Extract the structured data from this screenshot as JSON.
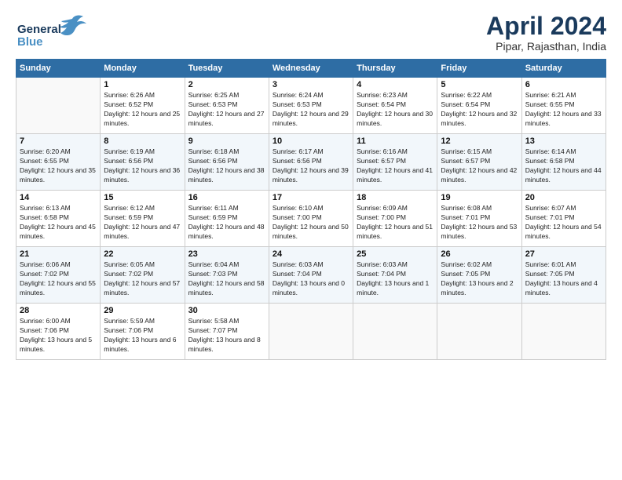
{
  "logo": {
    "line1": "General",
    "line2": "Blue"
  },
  "title": "April 2024",
  "subtitle": "Pipar, Rajasthan, India",
  "days_of_week": [
    "Sunday",
    "Monday",
    "Tuesday",
    "Wednesday",
    "Thursday",
    "Friday",
    "Saturday"
  ],
  "weeks": [
    [
      {
        "day": null
      },
      {
        "day": 1,
        "sunrise": "6:26 AM",
        "sunset": "6:52 PM",
        "daylight": "12 hours and 25 minutes."
      },
      {
        "day": 2,
        "sunrise": "6:25 AM",
        "sunset": "6:53 PM",
        "daylight": "12 hours and 27 minutes."
      },
      {
        "day": 3,
        "sunrise": "6:24 AM",
        "sunset": "6:53 PM",
        "daylight": "12 hours and 29 minutes."
      },
      {
        "day": 4,
        "sunrise": "6:23 AM",
        "sunset": "6:54 PM",
        "daylight": "12 hours and 30 minutes."
      },
      {
        "day": 5,
        "sunrise": "6:22 AM",
        "sunset": "6:54 PM",
        "daylight": "12 hours and 32 minutes."
      },
      {
        "day": 6,
        "sunrise": "6:21 AM",
        "sunset": "6:55 PM",
        "daylight": "12 hours and 33 minutes."
      }
    ],
    [
      {
        "day": 7,
        "sunrise": "6:20 AM",
        "sunset": "6:55 PM",
        "daylight": "12 hours and 35 minutes."
      },
      {
        "day": 8,
        "sunrise": "6:19 AM",
        "sunset": "6:56 PM",
        "daylight": "12 hours and 36 minutes."
      },
      {
        "day": 9,
        "sunrise": "6:18 AM",
        "sunset": "6:56 PM",
        "daylight": "12 hours and 38 minutes."
      },
      {
        "day": 10,
        "sunrise": "6:17 AM",
        "sunset": "6:56 PM",
        "daylight": "12 hours and 39 minutes."
      },
      {
        "day": 11,
        "sunrise": "6:16 AM",
        "sunset": "6:57 PM",
        "daylight": "12 hours and 41 minutes."
      },
      {
        "day": 12,
        "sunrise": "6:15 AM",
        "sunset": "6:57 PM",
        "daylight": "12 hours and 42 minutes."
      },
      {
        "day": 13,
        "sunrise": "6:14 AM",
        "sunset": "6:58 PM",
        "daylight": "12 hours and 44 minutes."
      }
    ],
    [
      {
        "day": 14,
        "sunrise": "6:13 AM",
        "sunset": "6:58 PM",
        "daylight": "12 hours and 45 minutes."
      },
      {
        "day": 15,
        "sunrise": "6:12 AM",
        "sunset": "6:59 PM",
        "daylight": "12 hours and 47 minutes."
      },
      {
        "day": 16,
        "sunrise": "6:11 AM",
        "sunset": "6:59 PM",
        "daylight": "12 hours and 48 minutes."
      },
      {
        "day": 17,
        "sunrise": "6:10 AM",
        "sunset": "7:00 PM",
        "daylight": "12 hours and 50 minutes."
      },
      {
        "day": 18,
        "sunrise": "6:09 AM",
        "sunset": "7:00 PM",
        "daylight": "12 hours and 51 minutes."
      },
      {
        "day": 19,
        "sunrise": "6:08 AM",
        "sunset": "7:01 PM",
        "daylight": "12 hours and 53 minutes."
      },
      {
        "day": 20,
        "sunrise": "6:07 AM",
        "sunset": "7:01 PM",
        "daylight": "12 hours and 54 minutes."
      }
    ],
    [
      {
        "day": 21,
        "sunrise": "6:06 AM",
        "sunset": "7:02 PM",
        "daylight": "12 hours and 55 minutes."
      },
      {
        "day": 22,
        "sunrise": "6:05 AM",
        "sunset": "7:02 PM",
        "daylight": "12 hours and 57 minutes."
      },
      {
        "day": 23,
        "sunrise": "6:04 AM",
        "sunset": "7:03 PM",
        "daylight": "12 hours and 58 minutes."
      },
      {
        "day": 24,
        "sunrise": "6:03 AM",
        "sunset": "7:04 PM",
        "daylight": "13 hours and 0 minutes."
      },
      {
        "day": 25,
        "sunrise": "6:03 AM",
        "sunset": "7:04 PM",
        "daylight": "13 hours and 1 minute."
      },
      {
        "day": 26,
        "sunrise": "6:02 AM",
        "sunset": "7:05 PM",
        "daylight": "13 hours and 2 minutes."
      },
      {
        "day": 27,
        "sunrise": "6:01 AM",
        "sunset": "7:05 PM",
        "daylight": "13 hours and 4 minutes."
      }
    ],
    [
      {
        "day": 28,
        "sunrise": "6:00 AM",
        "sunset": "7:06 PM",
        "daylight": "13 hours and 5 minutes."
      },
      {
        "day": 29,
        "sunrise": "5:59 AM",
        "sunset": "7:06 PM",
        "daylight": "13 hours and 6 minutes."
      },
      {
        "day": 30,
        "sunrise": "5:58 AM",
        "sunset": "7:07 PM",
        "daylight": "13 hours and 8 minutes."
      },
      {
        "day": null
      },
      {
        "day": null
      },
      {
        "day": null
      },
      {
        "day": null
      }
    ]
  ]
}
